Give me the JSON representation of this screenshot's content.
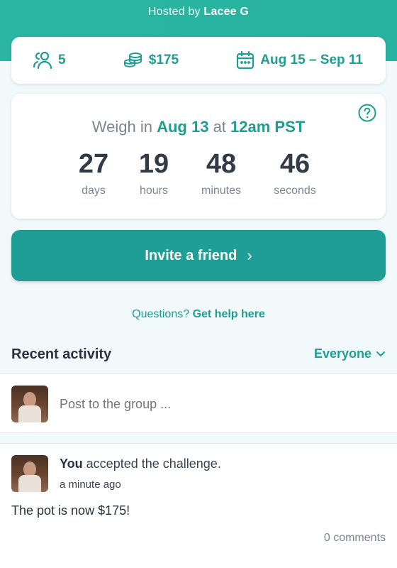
{
  "header": {
    "host_prefix": "Hosted by ",
    "host_name": "Lacee G",
    "bg_color": "#2bb5a3"
  },
  "stats": {
    "participants": "5",
    "pot": "$175",
    "dates": "Aug 15 – Sep 11",
    "icons": [
      "users-icon",
      "coins-icon",
      "calendar-icon"
    ]
  },
  "countdown": {
    "weigh_prefix": "Weigh in ",
    "weigh_date": "Aug 13",
    "weigh_at": " at ",
    "weigh_time": "12am PST",
    "units": [
      {
        "value": "27",
        "label": "days"
      },
      {
        "value": "19",
        "label": "hours"
      },
      {
        "value": "48",
        "label": "minutes"
      },
      {
        "value": "46",
        "label": "seconds"
      }
    ]
  },
  "invite": {
    "label": "Invite a friend",
    "chevron": "›"
  },
  "help": {
    "prefix": "Questions? ",
    "link": "Get help here"
  },
  "activity": {
    "title": "Recent activity",
    "filter": "Everyone",
    "post_placeholder": "Post to the group ..."
  },
  "feed": [
    {
      "actor": "You",
      "action": " accepted the challenge.",
      "time": "a minute ago",
      "body": "The pot is now $175!",
      "comments": "0 comments"
    }
  ],
  "colors": {
    "accent": "#1f9d91",
    "button": "#1f9e95",
    "background": "#f2f9fb"
  }
}
